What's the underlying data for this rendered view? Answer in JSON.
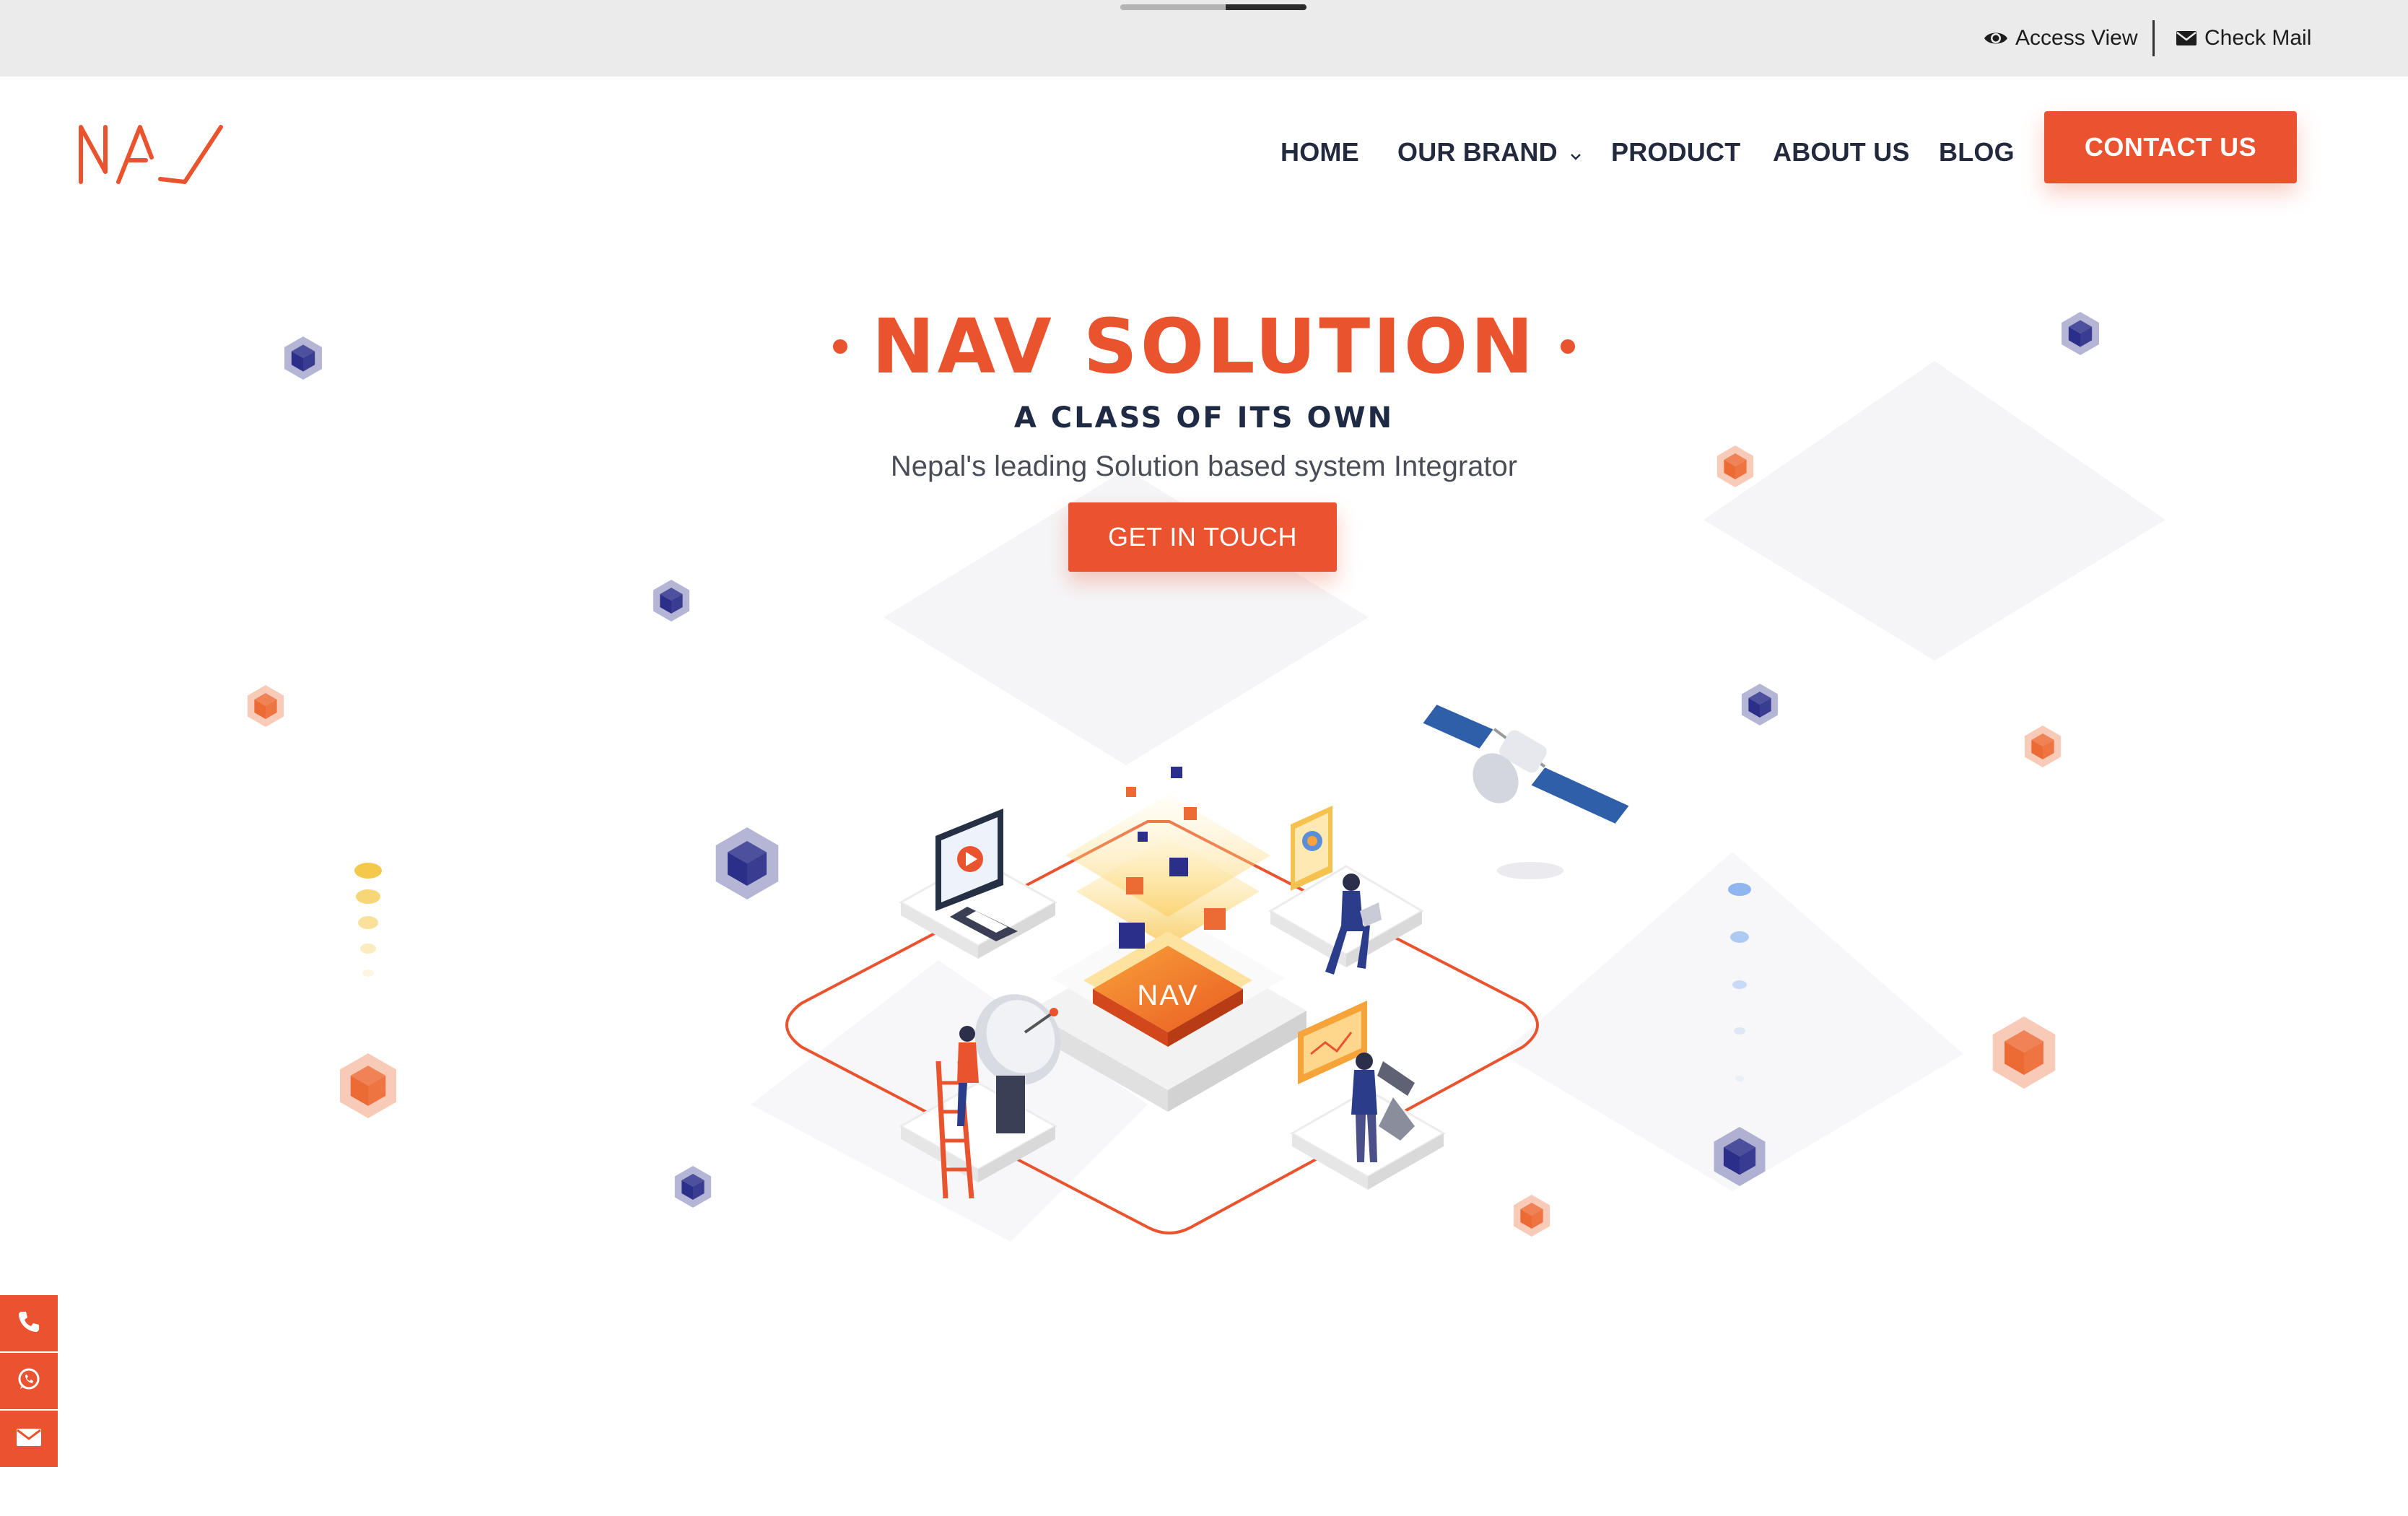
{
  "topbar": {
    "access_view": "Access View",
    "check_mail": "Check Mail",
    "access_icon": "eye-icon",
    "mail_icon": "envelope-icon"
  },
  "header": {
    "logo_text": "NAV",
    "nav": {
      "home": "HOME",
      "our_brand": "OUR BRAND",
      "product": "PRODUCT",
      "about_us": "ABOUT US",
      "blog": "BLOG"
    },
    "contact_button": "CONTACT US"
  },
  "hero": {
    "title": "NAV SOLUTION",
    "subtitle": "A CLASS OF ITS OWN",
    "description": "Nepal's leading Solution based system Integrator",
    "cta": "GET IN TOUCH",
    "illustration_logo": "NAV"
  },
  "floating_contact": {
    "icons": [
      "phone-icon",
      "whatsapp-icon",
      "envelope-icon"
    ]
  },
  "colors": {
    "accent": "#ea5230",
    "navy": "#1f2a44",
    "cube_orange": "#ec6b35",
    "cube_navy": "#2b2f8a",
    "topbar_bg": "#ebebeb"
  }
}
